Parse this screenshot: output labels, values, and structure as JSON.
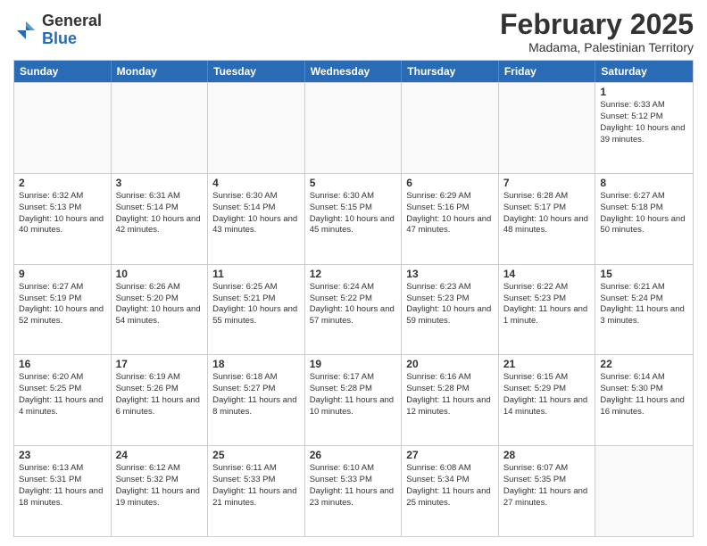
{
  "header": {
    "logo_general": "General",
    "logo_blue": "Blue",
    "cal_title": "February 2025",
    "cal_subtitle": "Madama, Palestinian Territory"
  },
  "days_of_week": [
    "Sunday",
    "Monday",
    "Tuesday",
    "Wednesday",
    "Thursday",
    "Friday",
    "Saturday"
  ],
  "weeks": [
    [
      {
        "day": "",
        "info": ""
      },
      {
        "day": "",
        "info": ""
      },
      {
        "day": "",
        "info": ""
      },
      {
        "day": "",
        "info": ""
      },
      {
        "day": "",
        "info": ""
      },
      {
        "day": "",
        "info": ""
      },
      {
        "day": "1",
        "info": "Sunrise: 6:33 AM\nSunset: 5:12 PM\nDaylight: 10 hours and 39 minutes."
      }
    ],
    [
      {
        "day": "2",
        "info": "Sunrise: 6:32 AM\nSunset: 5:13 PM\nDaylight: 10 hours and 40 minutes."
      },
      {
        "day": "3",
        "info": "Sunrise: 6:31 AM\nSunset: 5:14 PM\nDaylight: 10 hours and 42 minutes."
      },
      {
        "day": "4",
        "info": "Sunrise: 6:30 AM\nSunset: 5:14 PM\nDaylight: 10 hours and 43 minutes."
      },
      {
        "day": "5",
        "info": "Sunrise: 6:30 AM\nSunset: 5:15 PM\nDaylight: 10 hours and 45 minutes."
      },
      {
        "day": "6",
        "info": "Sunrise: 6:29 AM\nSunset: 5:16 PM\nDaylight: 10 hours and 47 minutes."
      },
      {
        "day": "7",
        "info": "Sunrise: 6:28 AM\nSunset: 5:17 PM\nDaylight: 10 hours and 48 minutes."
      },
      {
        "day": "8",
        "info": "Sunrise: 6:27 AM\nSunset: 5:18 PM\nDaylight: 10 hours and 50 minutes."
      }
    ],
    [
      {
        "day": "9",
        "info": "Sunrise: 6:27 AM\nSunset: 5:19 PM\nDaylight: 10 hours and 52 minutes."
      },
      {
        "day": "10",
        "info": "Sunrise: 6:26 AM\nSunset: 5:20 PM\nDaylight: 10 hours and 54 minutes."
      },
      {
        "day": "11",
        "info": "Sunrise: 6:25 AM\nSunset: 5:21 PM\nDaylight: 10 hours and 55 minutes."
      },
      {
        "day": "12",
        "info": "Sunrise: 6:24 AM\nSunset: 5:22 PM\nDaylight: 10 hours and 57 minutes."
      },
      {
        "day": "13",
        "info": "Sunrise: 6:23 AM\nSunset: 5:23 PM\nDaylight: 10 hours and 59 minutes."
      },
      {
        "day": "14",
        "info": "Sunrise: 6:22 AM\nSunset: 5:23 PM\nDaylight: 11 hours and 1 minute."
      },
      {
        "day": "15",
        "info": "Sunrise: 6:21 AM\nSunset: 5:24 PM\nDaylight: 11 hours and 3 minutes."
      }
    ],
    [
      {
        "day": "16",
        "info": "Sunrise: 6:20 AM\nSunset: 5:25 PM\nDaylight: 11 hours and 4 minutes."
      },
      {
        "day": "17",
        "info": "Sunrise: 6:19 AM\nSunset: 5:26 PM\nDaylight: 11 hours and 6 minutes."
      },
      {
        "day": "18",
        "info": "Sunrise: 6:18 AM\nSunset: 5:27 PM\nDaylight: 11 hours and 8 minutes."
      },
      {
        "day": "19",
        "info": "Sunrise: 6:17 AM\nSunset: 5:28 PM\nDaylight: 11 hours and 10 minutes."
      },
      {
        "day": "20",
        "info": "Sunrise: 6:16 AM\nSunset: 5:28 PM\nDaylight: 11 hours and 12 minutes."
      },
      {
        "day": "21",
        "info": "Sunrise: 6:15 AM\nSunset: 5:29 PM\nDaylight: 11 hours and 14 minutes."
      },
      {
        "day": "22",
        "info": "Sunrise: 6:14 AM\nSunset: 5:30 PM\nDaylight: 11 hours and 16 minutes."
      }
    ],
    [
      {
        "day": "23",
        "info": "Sunrise: 6:13 AM\nSunset: 5:31 PM\nDaylight: 11 hours and 18 minutes."
      },
      {
        "day": "24",
        "info": "Sunrise: 6:12 AM\nSunset: 5:32 PM\nDaylight: 11 hours and 19 minutes."
      },
      {
        "day": "25",
        "info": "Sunrise: 6:11 AM\nSunset: 5:33 PM\nDaylight: 11 hours and 21 minutes."
      },
      {
        "day": "26",
        "info": "Sunrise: 6:10 AM\nSunset: 5:33 PM\nDaylight: 11 hours and 23 minutes."
      },
      {
        "day": "27",
        "info": "Sunrise: 6:08 AM\nSunset: 5:34 PM\nDaylight: 11 hours and 25 minutes."
      },
      {
        "day": "28",
        "info": "Sunrise: 6:07 AM\nSunset: 5:35 PM\nDaylight: 11 hours and 27 minutes."
      },
      {
        "day": "",
        "info": ""
      }
    ]
  ]
}
